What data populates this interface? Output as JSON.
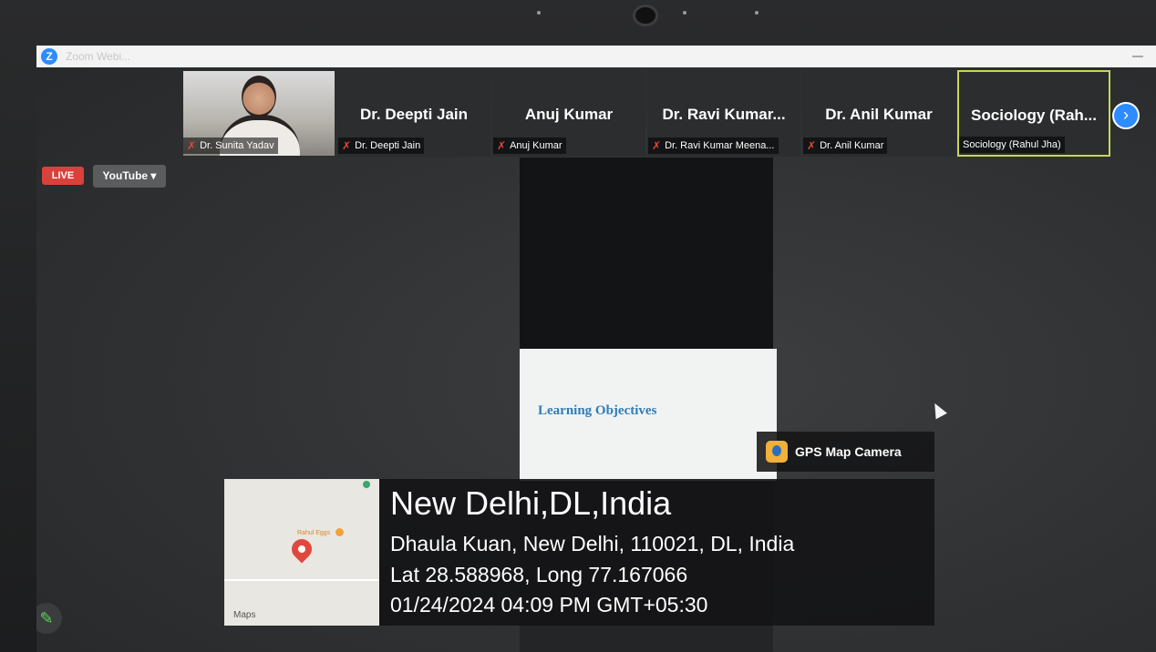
{
  "window": {
    "title": "Zoom Webi..."
  },
  "participants": [
    {
      "big_label": "",
      "name": "Dr. Sunita Yadav",
      "video": true,
      "active": false
    },
    {
      "big_label": "Dr. Deepti Jain",
      "name": "Dr. Deepti Jain",
      "video": false,
      "active": false
    },
    {
      "big_label": "Anuj Kumar",
      "name": "Anuj Kumar",
      "video": false,
      "active": false
    },
    {
      "big_label": "Dr. Ravi Kumar...",
      "name": "Dr. Ravi Kumar Meena...",
      "video": false,
      "active": false
    },
    {
      "big_label": "Dr. Anil Kumar",
      "name": "Dr. Anil Kumar",
      "video": false,
      "active": false
    },
    {
      "big_label": "Sociology (Rah...",
      "name": "Sociology (Rahul Jha)",
      "video": false,
      "active": true
    }
  ],
  "live": {
    "badge": "LIVE",
    "platform": "YouTube ▾"
  },
  "share": {
    "slide_title": "Learning Objectives"
  },
  "gps": {
    "app_name": "GPS Map Camera",
    "city": "New Delhi,DL,India",
    "address": "Dhaula Kuan, New Delhi, 110021, DL, India",
    "coords": "Lat 28.588968, Long 77.167066",
    "datetime": "01/24/2024 04:09 PM GMT+05:30",
    "map_poi": "Rahul Eggs",
    "map_label": "Maps"
  },
  "icons": {
    "mic_muted": "mic-muted-icon",
    "next": "chevron-right-icon",
    "annotate": "pencil-icon"
  },
  "colors": {
    "live": "#d9413b",
    "zoom_blue": "#2d8cff",
    "active_border": "#c9d657"
  }
}
